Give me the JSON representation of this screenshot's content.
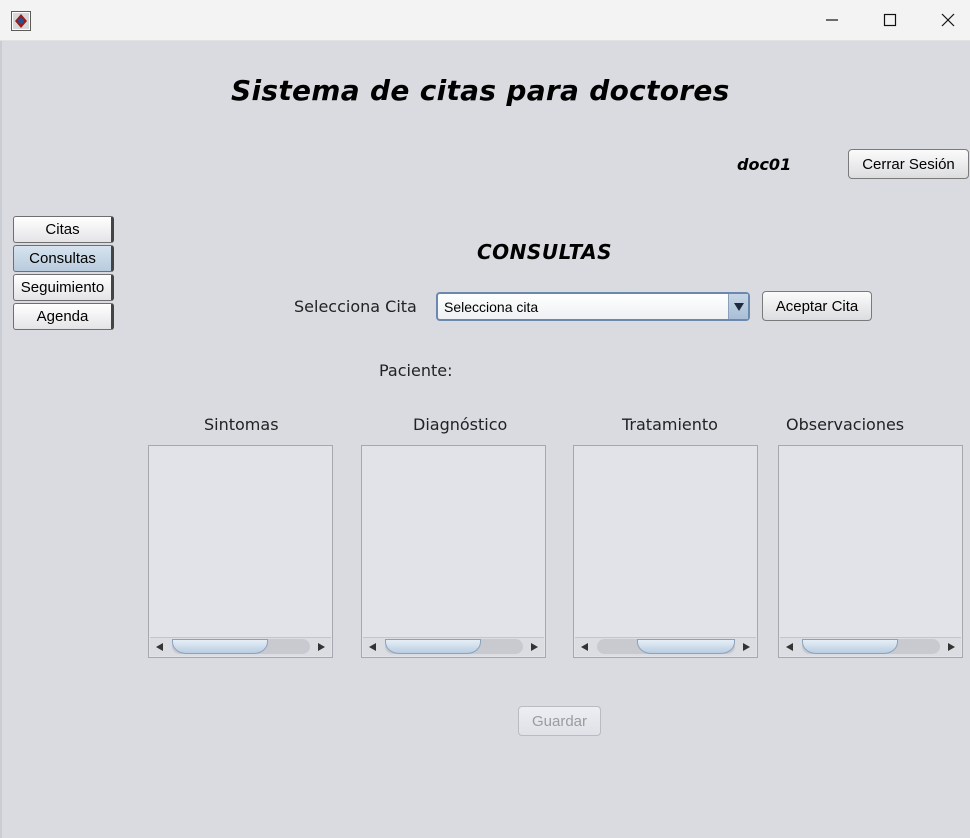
{
  "window": {
    "title": "",
    "app_icon": "java-app-icon",
    "controls": [
      "minimize-icon",
      "maximize-icon",
      "close-icon"
    ]
  },
  "app": {
    "title": "Sistema de citas para doctores",
    "user": "doc01",
    "logout_label": "Cerrar Sesión"
  },
  "sidebar": {
    "items": [
      {
        "label": "Citas",
        "active": false
      },
      {
        "label": "Consultas",
        "active": true
      },
      {
        "label": "Seguimiento",
        "active": false
      },
      {
        "label": "Agenda",
        "active": false
      }
    ]
  },
  "main": {
    "section_title": "CONSULTAS",
    "select_label": "Selecciona Cita",
    "select_value": "Selecciona cita",
    "accept_label": "Aceptar Cita",
    "patient_label": "Paciente:",
    "patient_value": "",
    "fields": [
      {
        "label": "Sintomas",
        "value": ""
      },
      {
        "label": "Diagnóstico",
        "value": ""
      },
      {
        "label": "Tratamiento",
        "value": ""
      },
      {
        "label": "Observaciones",
        "value": ""
      }
    ],
    "save_label": "Guardar"
  },
  "colors": {
    "background": "#d9dbe1",
    "active_tab": "#b8cbdd",
    "combo_border": "#6a89ac",
    "disabled_text": "#9a9ca2"
  }
}
